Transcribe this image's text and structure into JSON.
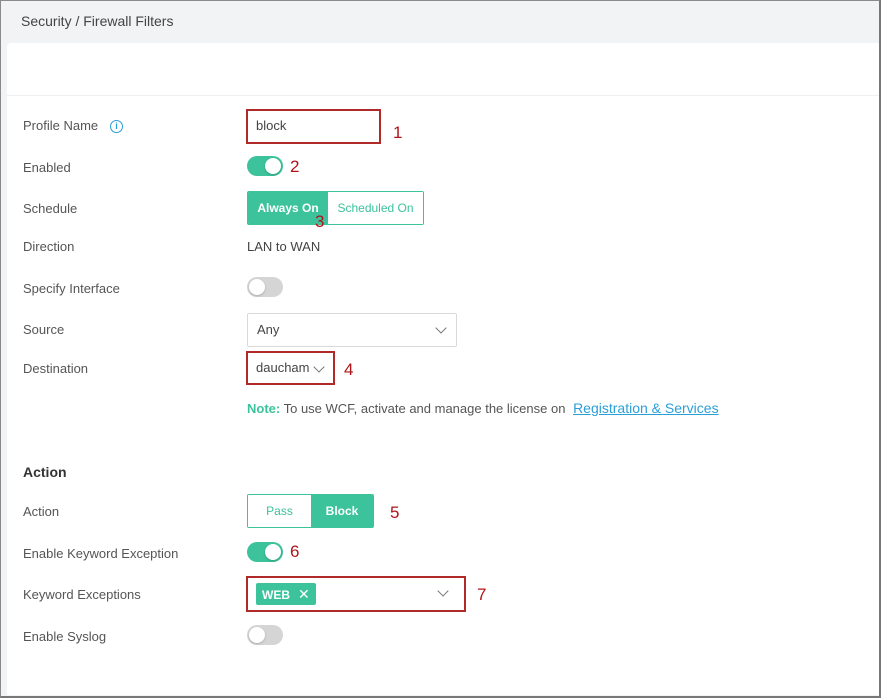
{
  "breadcrumb": "Security / Firewall Filters",
  "form": {
    "profile_name_label": "Profile Name",
    "profile_name_value": "block",
    "enabled_label": "Enabled",
    "enabled": true,
    "schedule_label": "Schedule",
    "schedule_options": [
      "Always On",
      "Scheduled On"
    ],
    "schedule_selected": "Always On",
    "direction_label": "Direction",
    "direction_value": "LAN to WAN",
    "specify_interface_label": "Specify Interface",
    "specify_interface": false,
    "source_label": "Source",
    "source_value": "Any",
    "destination_label": "Destination",
    "destination_value": "daucham",
    "note_label": "Note:",
    "note_text": "To use WCF, activate and manage the license on",
    "note_link": "Registration & Services"
  },
  "action_section": {
    "title": "Action",
    "action_label": "Action",
    "action_options": [
      "Pass",
      "Block"
    ],
    "action_selected": "Block",
    "keyword_exception_label": "Enable Keyword Exception",
    "keyword_exception": true,
    "keyword_exceptions_label": "Keyword Exceptions",
    "keyword_tags": [
      "WEB"
    ],
    "syslog_label": "Enable Syslog",
    "syslog": false
  },
  "annotations": [
    "1",
    "2",
    "3",
    "4",
    "5",
    "6",
    "7"
  ],
  "colors": {
    "accent": "#3cc39b",
    "link": "#2a9fd8",
    "annotation": "#b0141a"
  }
}
